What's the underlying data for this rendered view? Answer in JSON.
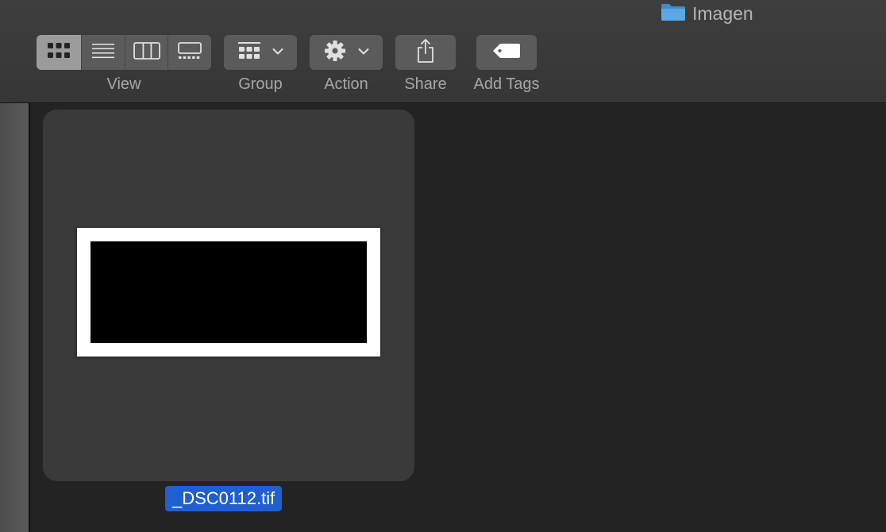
{
  "window": {
    "title": "Imagen"
  },
  "toolbar": {
    "view_label": "View",
    "group_label": "Group",
    "action_label": "Action",
    "share_label": "Share",
    "add_tags_label": "Add Tags",
    "view_modes": [
      "icon-view-icon",
      "list-view-icon",
      "column-view-icon",
      "gallery-view-icon"
    ],
    "active_view": "icon"
  },
  "files": [
    {
      "name": "_DSC0112.tif",
      "selected": true
    }
  ],
  "colors": {
    "selection": "#1f5fd0",
    "folder": "#5aa9e6"
  }
}
